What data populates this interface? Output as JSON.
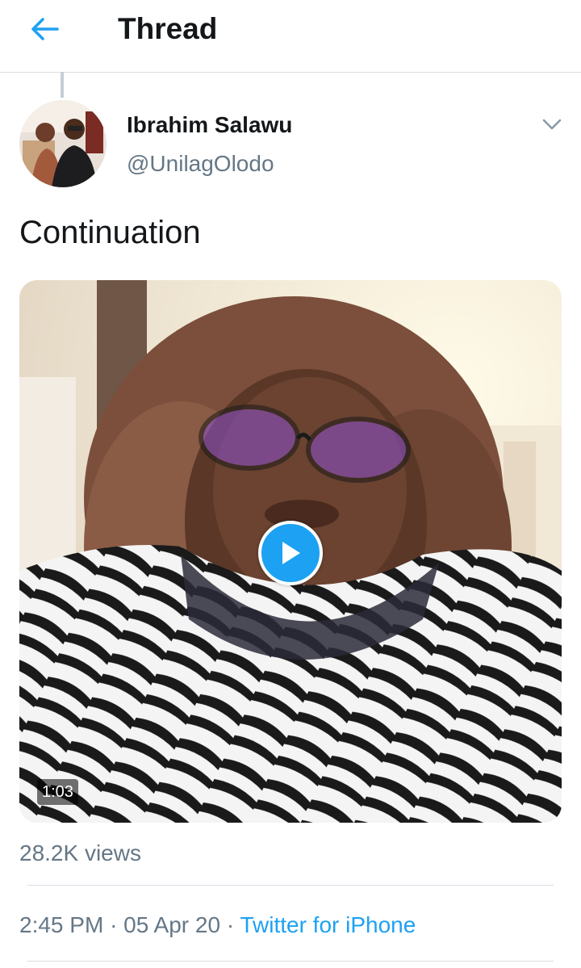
{
  "header": {
    "title": "Thread"
  },
  "tweet": {
    "display_name": "Ibrahim Salawu",
    "handle": "@UnilagOlodo",
    "text": "Continuation",
    "video_duration": "1:03",
    "views": "28.2K views",
    "time": "2:45 PM",
    "date": "05 Apr 20",
    "separator": "·",
    "source": "Twitter for iPhone"
  },
  "colors": {
    "accent": "#1da1f2",
    "secondary_text": "#657786",
    "divider": "#d8dde2"
  },
  "icons": {
    "back": "arrow-left-icon",
    "menu": "chevron-down-icon",
    "play": "play-icon"
  }
}
